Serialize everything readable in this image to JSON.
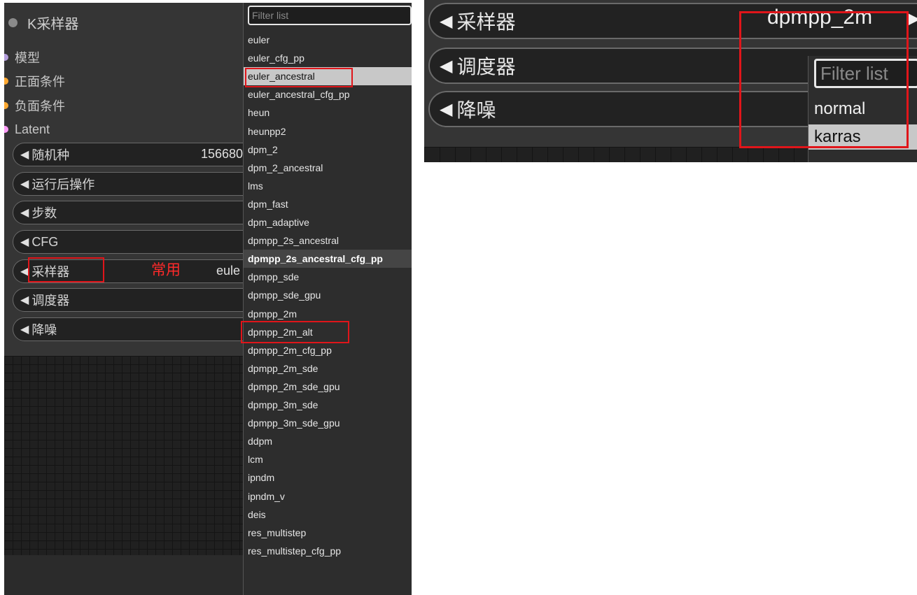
{
  "node": {
    "title": "K采样器",
    "inputs": [
      {
        "label": "模型",
        "color": "#b39ddb"
      },
      {
        "label": "正面条件",
        "color": "#ffa931"
      },
      {
        "label": "负面条件",
        "color": "#ffa931"
      },
      {
        "label": "Latent",
        "color": "#ff9cf9"
      }
    ],
    "widgets": [
      {
        "label": "随机种",
        "value": "156680"
      },
      {
        "label": "运行后操作",
        "value": ""
      },
      {
        "label": "步数",
        "value": ""
      },
      {
        "label": "CFG",
        "value": ""
      },
      {
        "label": "采样器",
        "value": "eule"
      },
      {
        "label": "调度器",
        "value": ""
      },
      {
        "label": "降噪",
        "value": ""
      }
    ],
    "annotation": "常用"
  },
  "sampler_menu": {
    "filter_placeholder": "Filter list",
    "items": [
      "euler",
      "euler_cfg_pp",
      "euler_ancestral",
      "euler_ancestral_cfg_pp",
      "heun",
      "heunpp2",
      "dpm_2",
      "dpm_2_ancestral",
      "lms",
      "dpm_fast",
      "dpm_adaptive",
      "dpmpp_2s_ancestral",
      "dpmpp_2s_ancestral_cfg_pp",
      "dpmpp_sde",
      "dpmpp_sde_gpu",
      "dpmpp_2m",
      "dpmpp_2m_alt",
      "dpmpp_2m_cfg_pp",
      "dpmpp_2m_sde",
      "dpmpp_2m_sde_gpu",
      "dpmpp_3m_sde",
      "dpmpp_3m_sde_gpu",
      "ddpm",
      "lcm",
      "ipndm",
      "ipndm_v",
      "deis",
      "res_multistep",
      "res_multistep_cfg_pp"
    ],
    "selected": "euler_ancestral",
    "hovered": "dpmpp_2s_ancestral_cfg_pp"
  },
  "zoom": {
    "widgets": [
      {
        "label": "采样器",
        "value": "dpmpp_2m"
      },
      {
        "label": "调度器",
        "value": ""
      },
      {
        "label": "降噪",
        "value": ""
      }
    ],
    "filter_placeholder": "Filter list",
    "items": [
      "normal",
      "karras"
    ],
    "selected": "karras"
  }
}
